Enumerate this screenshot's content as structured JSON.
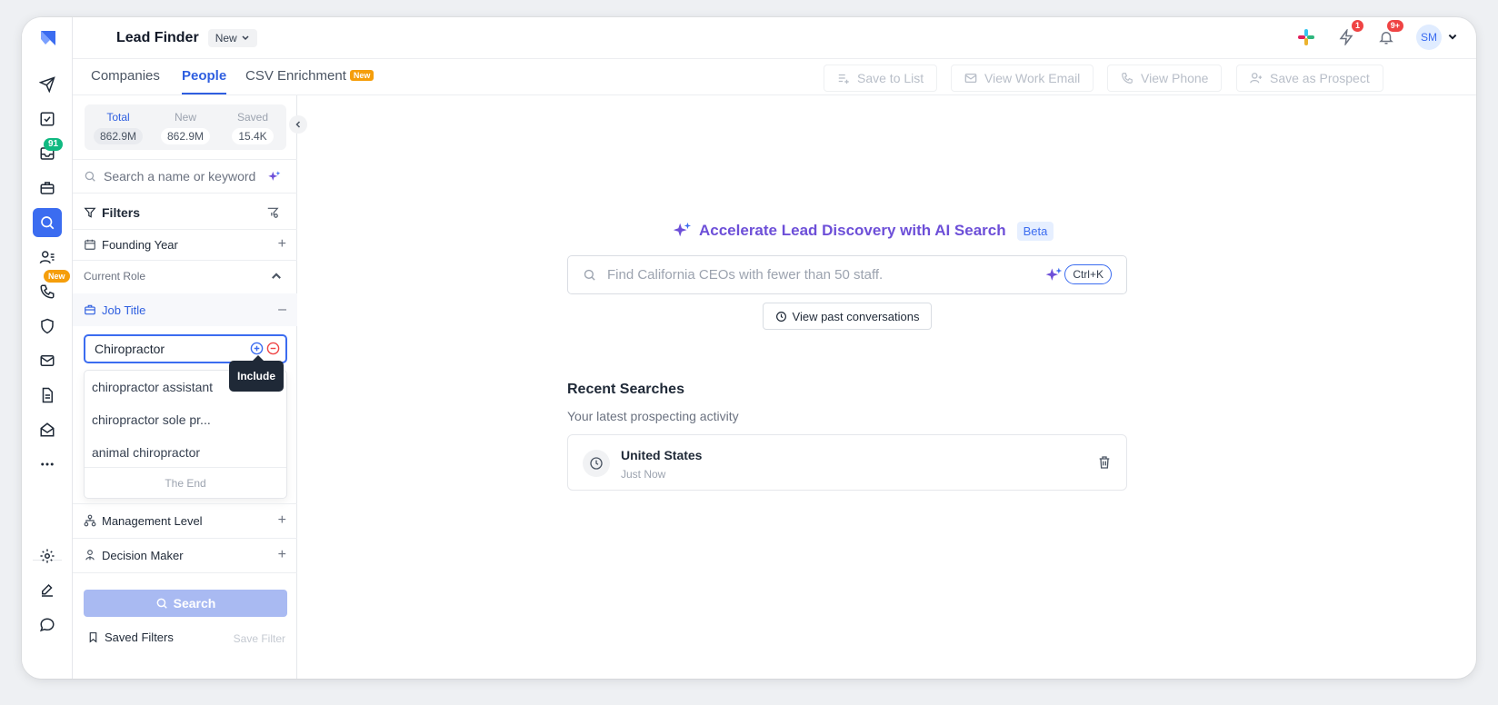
{
  "header": {
    "title": "Lead Finder",
    "view_dropdown": "New",
    "notifications_badge": "1",
    "alerts_badge": "9+",
    "avatar_initials": "SM"
  },
  "rail": {
    "inbox_badge": "91",
    "calls_badge": "New"
  },
  "tabs": [
    {
      "label": "Companies"
    },
    {
      "label": "People"
    },
    {
      "label": "CSV Enrichment",
      "badge": "New"
    }
  ],
  "actions": {
    "save_to_list": "Save to List",
    "view_work_email": "View Work Email",
    "view_phone": "View Phone",
    "save_as_prospect": "Save as Prospect"
  },
  "stats": [
    {
      "label": "Total",
      "value": "862.9M"
    },
    {
      "label": "New",
      "value": "862.9M"
    },
    {
      "label": "Saved",
      "value": "15.4K"
    }
  ],
  "panel": {
    "search_placeholder": "Search a name or keyword",
    "filters_label": "Filters",
    "founding_year": "Founding Year",
    "current_role": "Current Role",
    "job_title": "Job Title",
    "job_title_value": "Chiropractor",
    "include_tooltip": "Include",
    "suggestions": [
      "chiropractor assistant",
      "chiropractor sole pr...",
      "animal chiropractor"
    ],
    "the_end": "The End",
    "management_level": "Management Level",
    "decision_maker": "Decision Maker",
    "search_button": "Search",
    "saved_filters": "Saved Filters",
    "save_filter": "Save Filter"
  },
  "main": {
    "ai_title": "Accelerate Lead Discovery with AI Search",
    "beta": "Beta",
    "ai_placeholder": "Find California CEOs with fewer than 50 staff.",
    "shortcut": "Ctrl+K",
    "past_conversations": "View past conversations",
    "recent_title": "Recent Searches",
    "recent_subtitle": "Your latest prospecting activity",
    "recent_items": [
      {
        "title": "United States",
        "time": "Just Now"
      }
    ]
  },
  "colors": {
    "accent": "#3b6cf0",
    "ai_purple": "#6d4fd8",
    "badge_red": "#ef4444",
    "badge_green": "#10b981",
    "badge_orange": "#f59e0b"
  }
}
